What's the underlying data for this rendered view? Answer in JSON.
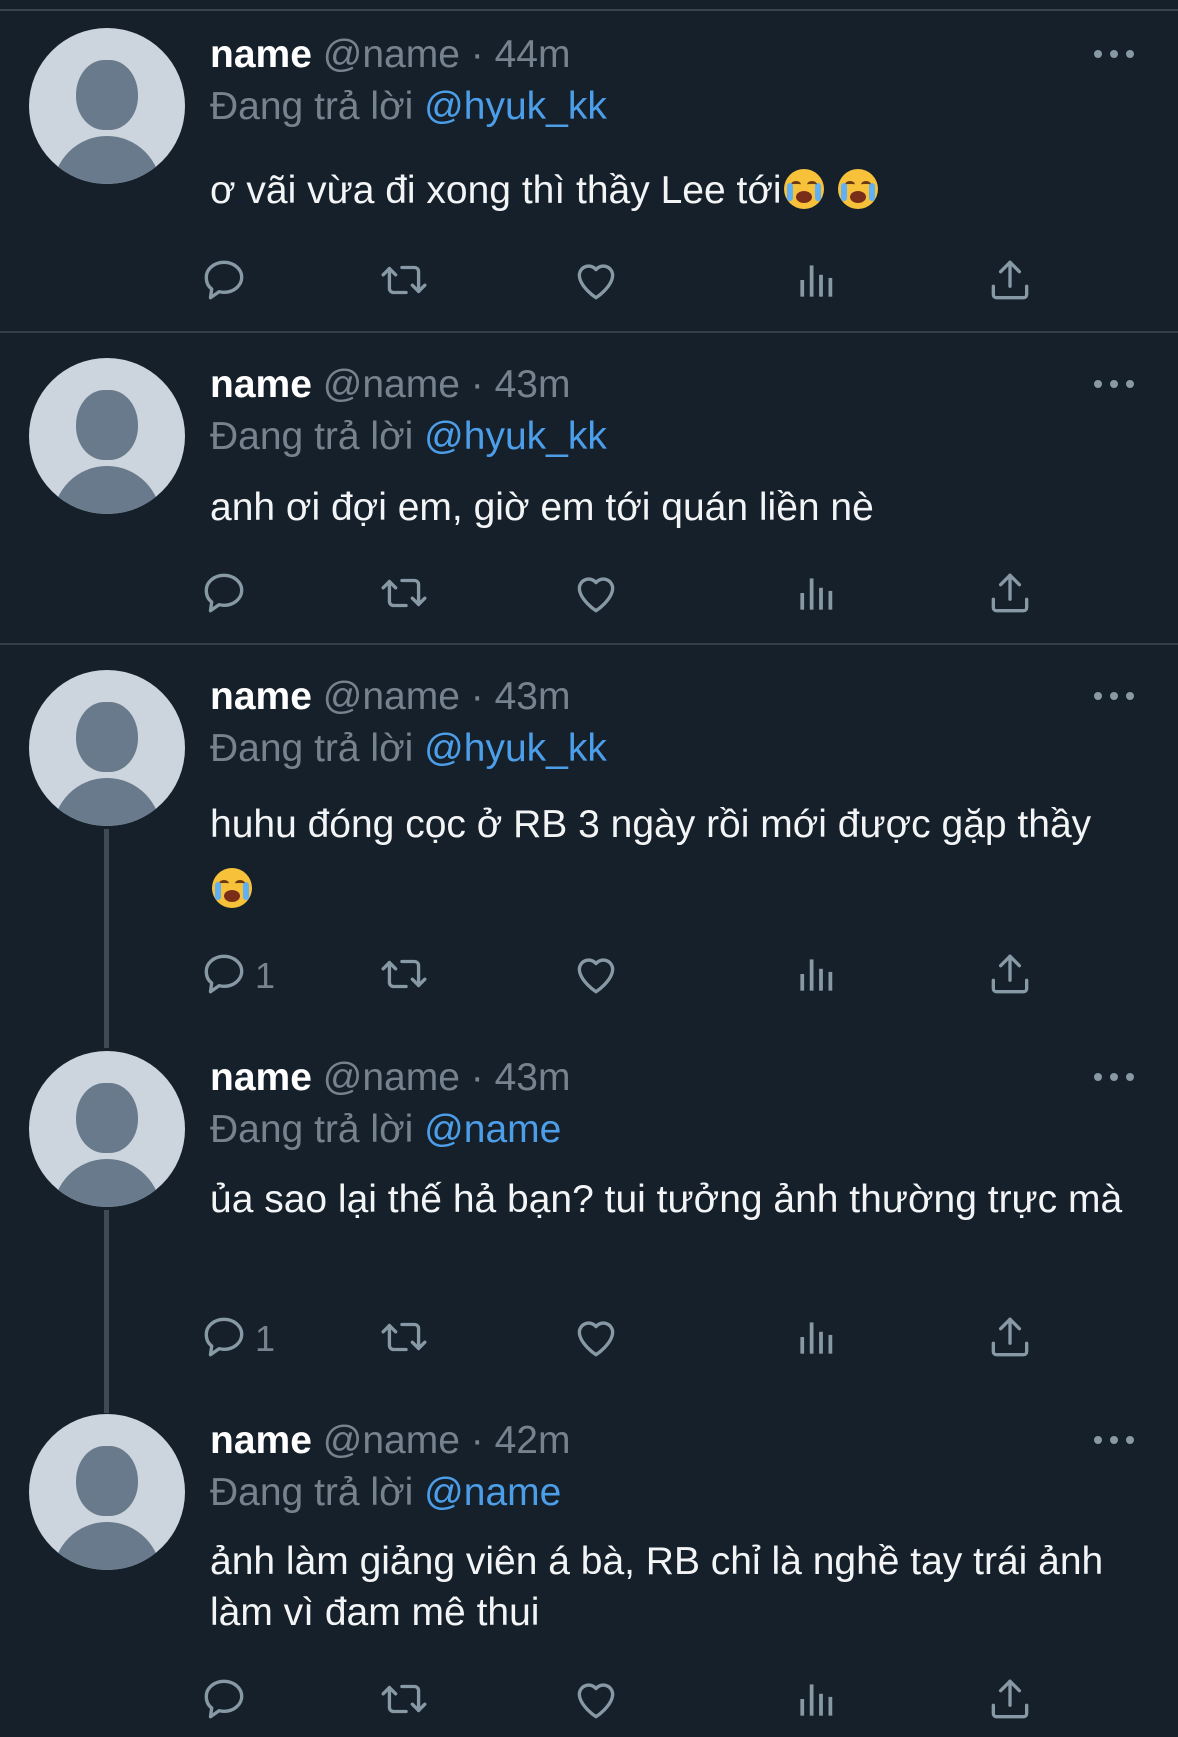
{
  "tweets": [
    {
      "name": "name",
      "handle": "@name",
      "time": "44m",
      "reply_prefix": "Đang trả lời",
      "reply_to": "@hyuk_kk",
      "text": "ơ vãi vừa đi xong thì thầy Lee tới",
      "emoji_count": 2,
      "reply_count": ""
    },
    {
      "name": "name",
      "handle": "@name",
      "time": "43m",
      "reply_prefix": "Đang trả lời",
      "reply_to": "@hyuk_kk",
      "text": "anh ơi đợi em, giờ em tới quán liền nè",
      "emoji_count": 0,
      "reply_count": ""
    },
    {
      "name": "name",
      "handle": "@name",
      "time": "43m",
      "reply_prefix": "Đang trả lời",
      "reply_to": "@hyuk_kk",
      "text": "huhu đóng cọc ở RB 3 ngày rồi mới được gặp thầy",
      "emoji_count": 1,
      "reply_count": "1"
    },
    {
      "name": "name",
      "handle": "@name",
      "time": "43m",
      "reply_prefix": "Đang trả lời",
      "reply_to": "@name",
      "text": "ủa sao lại thế hả bạn? tui tưởng ảnh thường trực mà",
      "emoji_count": 0,
      "reply_count": "1"
    },
    {
      "name": "name",
      "handle": "@name",
      "time": "42m",
      "reply_prefix": "Đang trả lời",
      "reply_to": "@name",
      "text": "ảnh làm giảng viên á bà, RB chỉ là nghề tay trái ảnh làm vì đam mê thui",
      "emoji_count": 0,
      "reply_count": ""
    }
  ],
  "separator": "·",
  "icons": [
    "reply-icon",
    "retweet-icon",
    "like-icon",
    "views-icon",
    "share-icon",
    "more-icon",
    "loudly-crying-face-emoji"
  ],
  "colors": {
    "background": "#16202b",
    "accent": "#4c9ee8",
    "muted": "#76838f",
    "avatar": "#ccd5dd"
  }
}
